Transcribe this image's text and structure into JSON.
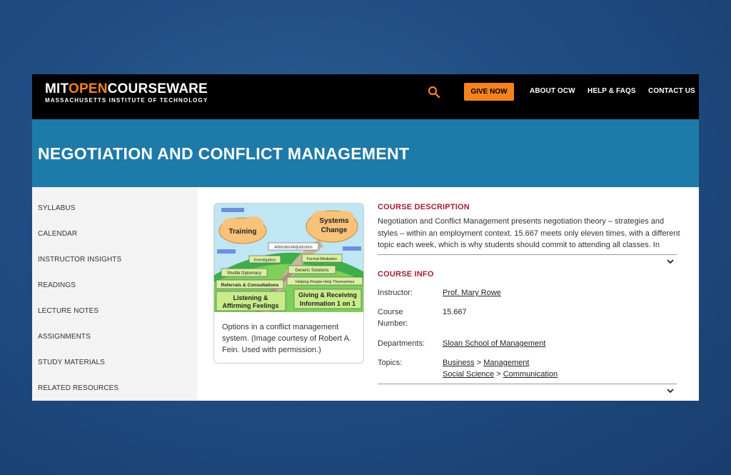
{
  "header": {
    "logo_mit": "MIT",
    "logo_open": "OPEN",
    "logo_cw": "COURSEWARE",
    "logo_sub": "MASSACHUSETTS INSTITUTE OF TECHNOLOGY",
    "give_now": "GIVE NOW",
    "nav": [
      "ABOUT OCW",
      "HELP & FAQS",
      "CONTACT US"
    ]
  },
  "course": {
    "title": "NEGOTIATION AND CONFLICT MANAGEMENT"
  },
  "sidebar": {
    "items": [
      {
        "label": "SYLLABUS"
      },
      {
        "label": "CALENDAR"
      },
      {
        "label": "INSTRUCTOR INSIGHTS"
      },
      {
        "label": "READINGS"
      },
      {
        "label": "LECTURE NOTES"
      },
      {
        "label": "ASSIGNMENTS"
      },
      {
        "label": "STUDY MATERIALS"
      },
      {
        "label": "RELATED RESOURCES"
      }
    ]
  },
  "image_card": {
    "labels": {
      "training": "Training",
      "systems1": "Systems",
      "systems2": "Change",
      "arbitration": "Arbitration/Adjudication",
      "investigation": "Investigation",
      "formal_mediation": "Formal Mediation",
      "generic_solutions": "Generic Solutions",
      "shuttle": "Shuttle Diplomacy",
      "helping": "Helping People Help Themselves",
      "referrals": "Referrals & Consultations",
      "listening1": "Listening &",
      "listening2": "Affirming Feelings",
      "giving1": "Giving & Receiving",
      "giving2": "Information 1 on 1"
    },
    "caption": "Options in a conflict management system. (Image courtesy of Robert A. Fein. Used with permission.)"
  },
  "description": {
    "heading": "COURSE DESCRIPTION",
    "text": "Negotiation and Conflict Management presents negotiation theory – strategies and styles – within an employment context. 15.667 meets only eleven times, with a different topic each week, which is why students should commit to attending all classes. In"
  },
  "info": {
    "heading": "COURSE INFO",
    "instructor_label": "Instructor:",
    "instructor": "Prof. Mary Rowe",
    "number_label_1": "Course",
    "number_label_2": "Number:",
    "number": "15.667",
    "departments_label": "Departments:",
    "department": "Sloan School of Management",
    "topics_label": "Topics:",
    "topic1_a": "Business",
    "topic1_b": "Management",
    "topic2_a": "Social Science",
    "topic2_b": "Communication",
    "separator": ">"
  },
  "colors": {
    "accent_orange": "#f5821f",
    "title_band": "#1e7aa8",
    "section_red": "#a31f34"
  }
}
